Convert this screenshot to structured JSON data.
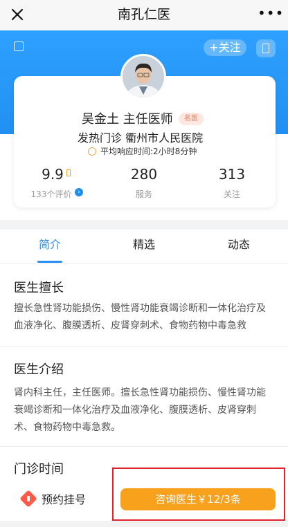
{
  "nav": {
    "title": "南孔仁医",
    "more": "•••",
    "close_icon": "close-icon"
  },
  "header": {
    "follow_label": "+关注",
    "left_icon": "share-icon",
    "right_icon": "document-icon",
    "accent_color": "#2190f2"
  },
  "doctor": {
    "name_title": "吴金土  主任医师",
    "badge": "名医",
    "dept_hospital": "发热门诊  衢州市人民医院",
    "response_time": "平均响应时间:2小时8分钟"
  },
  "stats": [
    {
      "value": "9.9",
      "label": "133个评价"
    },
    {
      "value": "280",
      "label": "服务"
    },
    {
      "value": "313",
      "label": "关注"
    }
  ],
  "tabs": [
    {
      "label": "简介",
      "active": true
    },
    {
      "label": "精选",
      "active": false
    },
    {
      "label": "动态",
      "active": false
    }
  ],
  "sections": {
    "expertise_title": "医生擅长",
    "expertise_body": "擅长急性肾功能损伤、慢性肾功能衰竭诊断和一体化治疗及血液净化、腹膜透析、皮肾穿刺术、食物药物中毒急救",
    "intro_title": "医生介绍",
    "intro_body": "肾内科主任，主任医师。擅长急性肾功能损伤、慢性肾功能衰竭诊断和一体化治疗及血液净化、腹膜透析、皮肾穿刺术、食物药物中毒急救。",
    "schedule_title": "门诊时间"
  },
  "bottom_bar": {
    "appointment_label": "预约挂号",
    "consult_label": "咨询医生￥12/3条",
    "consult_color": "#f7a11d"
  }
}
